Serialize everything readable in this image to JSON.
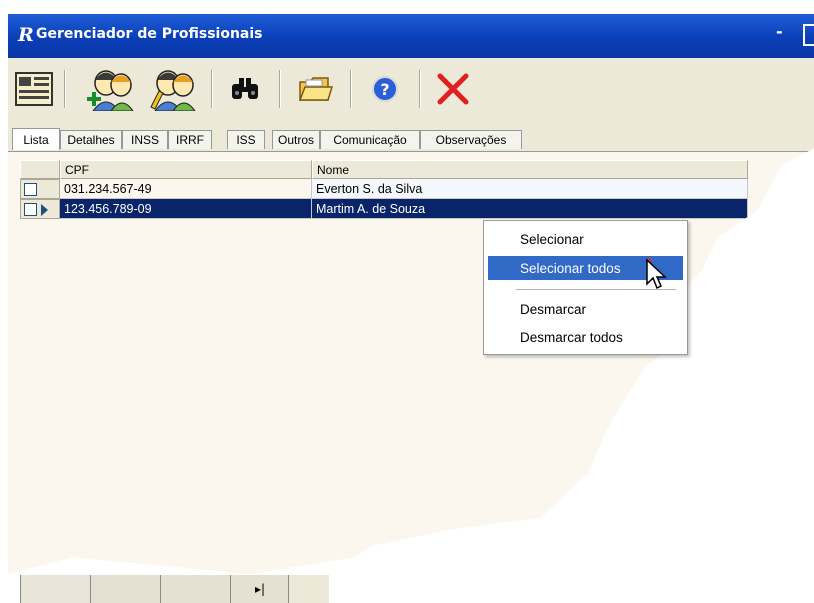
{
  "window": {
    "app_icon": "R",
    "title": "Gerenciador de Profissionais",
    "minimize_label": "-"
  },
  "toolbar": {
    "buttons": [
      {
        "name": "list-view-icon"
      },
      {
        "name": "add-professional-icon"
      },
      {
        "name": "edit-professional-icon"
      },
      {
        "name": "binoculars-search-icon"
      },
      {
        "name": "open-folder-icon"
      },
      {
        "name": "help-icon"
      },
      {
        "name": "delete-x-icon"
      }
    ],
    "colors": {
      "help": "#2b5fd9",
      "delete": "#e02020",
      "folder": "#f0c848"
    }
  },
  "tabs": [
    {
      "label": "Lista"
    },
    {
      "label": "Detalhes"
    },
    {
      "label": "INSS"
    },
    {
      "label": "IRRF"
    },
    {
      "label": "ISS"
    },
    {
      "label": "Outros"
    },
    {
      "label": "Comunicação"
    },
    {
      "label": "Observações"
    }
  ],
  "grid": {
    "columns": [
      "CPF",
      "Nome"
    ],
    "rows": [
      {
        "cpf": "031.234.567-49",
        "nome": "Everton S. da Silva",
        "selected": false
      },
      {
        "cpf": "123.456.789-09",
        "nome": "Martim A. de Souza",
        "selected": true
      }
    ]
  },
  "context_menu": {
    "items": [
      "Selecionar",
      "Selecionar todos",
      "Desmarcar",
      "Desmarcar todos"
    ],
    "highlighted": "Selecionar todos"
  },
  "navigator": {
    "last_label": "▸|"
  },
  "colors": {
    "titlebar": "#0b3fb8",
    "selection": "#0a246a",
    "menu_highlight": "#3169c6"
  }
}
